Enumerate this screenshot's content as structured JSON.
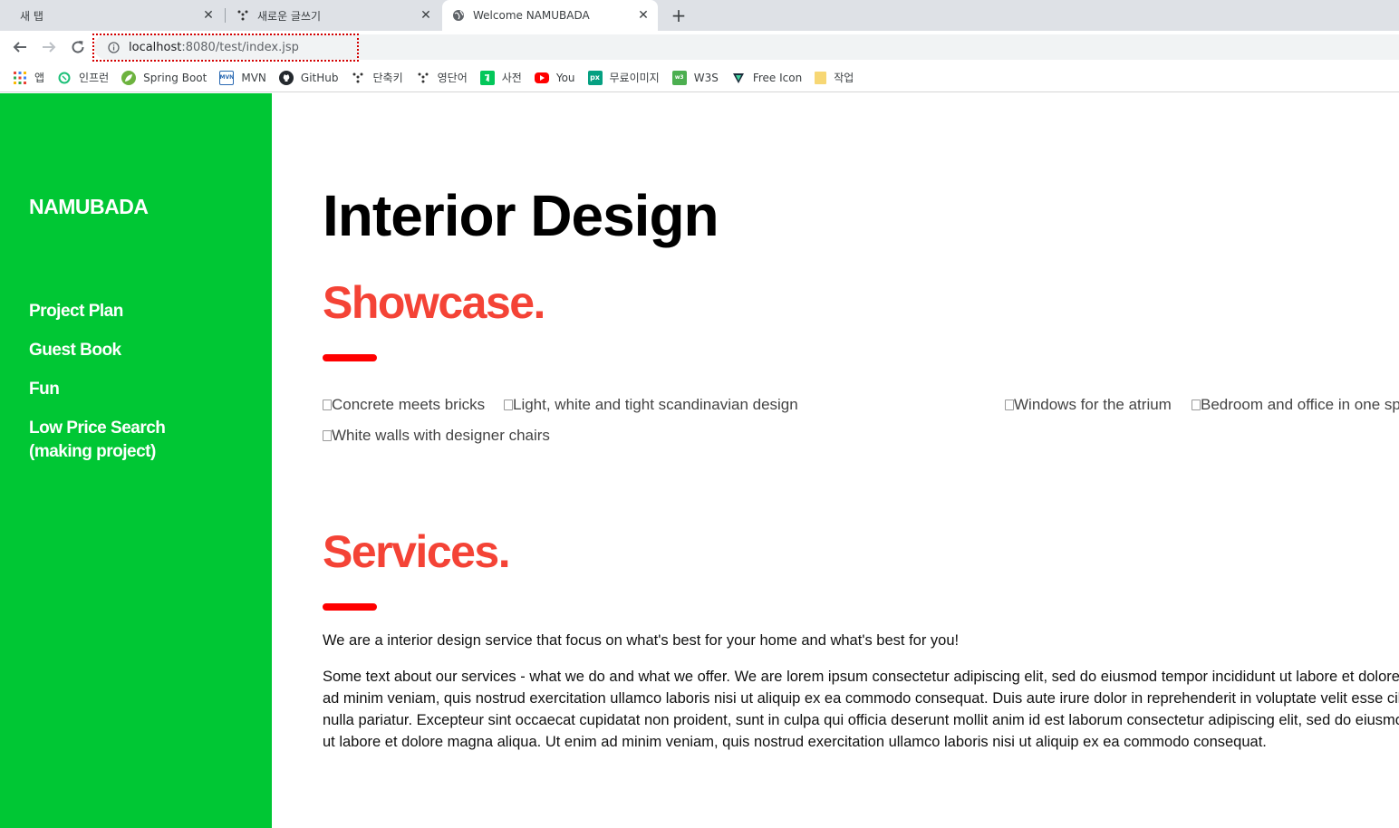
{
  "browser": {
    "tabs": [
      {
        "label": "새 탭",
        "icon": "none",
        "active": false
      },
      {
        "label": "새로운 글쓰기",
        "icon": "dots-icon",
        "active": false
      },
      {
        "label": "Welcome NAMUBADA",
        "icon": "globe-icon",
        "active": true
      }
    ],
    "new_tab_glyph": "+",
    "close_glyph": "✕",
    "url": {
      "host": "localhost",
      "rest": ":8080/test/index.jsp"
    },
    "bookmarks": [
      {
        "label": "앱",
        "icon": "apps-grid-icon"
      },
      {
        "label": "인프런",
        "icon": "inflearn-icon"
      },
      {
        "label": "Spring Boot",
        "icon": "spring-icon"
      },
      {
        "label": "MVN",
        "icon": "mvn-icon"
      },
      {
        "label": "GitHub",
        "icon": "github-icon"
      },
      {
        "label": "단축키",
        "icon": "dots-icon"
      },
      {
        "label": "영단어",
        "icon": "dots-icon"
      },
      {
        "label": "사전",
        "icon": "dictionary-icon"
      },
      {
        "label": "You",
        "icon": "youtube-icon"
      },
      {
        "label": "무료이미지",
        "icon": "px-icon"
      },
      {
        "label": "W3S",
        "icon": "w3s-icon"
      },
      {
        "label": "Free Icon",
        "icon": "freeicon-icon"
      },
      {
        "label": "작업",
        "icon": "folder-icon"
      }
    ]
  },
  "sidebar": {
    "brand": "NAMUBADA",
    "items": [
      {
        "label": "Project Plan"
      },
      {
        "label": "Guest Book"
      },
      {
        "label": "Fun"
      },
      {
        "label": "Low Price Search (making project)"
      }
    ]
  },
  "main": {
    "title": "Interior Design",
    "showcase_heading": "Showcase.",
    "images": [
      "Concrete meets bricks",
      "Light, white and tight scandinavian design",
      "Windows for the atrium",
      "Bedroom and office in one space",
      "White walls with designer chairs"
    ],
    "services_heading": "Services.",
    "services_intro": "We are a interior design service that focus on what's best for your home and what's best for you!",
    "services_body_lines": [
      "Some text about our services - what we do and what we offer. We are lorem ipsum consectetur adipiscing elit, sed do eiusmod tempor incididunt ut labore et dolore magna aliqua. Ut enim",
      "ad minim veniam, quis nostrud exercitation ullamco laboris nisi ut aliquip ex ea commodo consequat. Duis aute irure dolor in reprehenderit in voluptate velit esse cillum dolore eu fugiat",
      "nulla pariatur. Excepteur sint occaecat cupidatat non proident, sunt in culpa qui officia deserunt mollit anim id est laborum consectetur adipiscing elit, sed do eiusmod tempor incididunt",
      "ut labore et dolore magna aliqua. Ut enim ad minim veniam, quis nostrud exercitation ullamco laboris nisi ut aliquip ex ea commodo consequat."
    ]
  },
  "colors": {
    "sidebar_bg": "#00c734",
    "heading_red": "#f44336",
    "bar_red": "#ff0000"
  }
}
